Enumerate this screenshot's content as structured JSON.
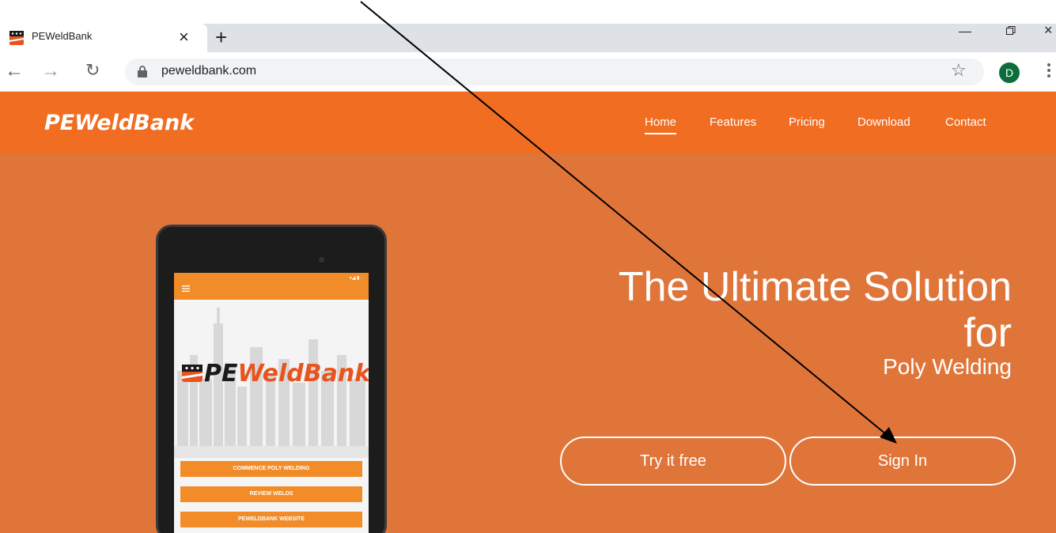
{
  "browser": {
    "tab_title": "PEWeldBank",
    "url": "peweldbank.com",
    "profile_initial": "D"
  },
  "site": {
    "brand": "PEWeldBank",
    "nav": [
      "Home",
      "Features",
      "Pricing",
      "Download",
      "Contact"
    ],
    "active_nav": "Home",
    "hero_line1": "The Ultimate Solution",
    "hero_line2": "for",
    "hero_sub": "Poly Welding",
    "try_button": "Try it free",
    "signin_button": "Sign In",
    "colors": {
      "header": "#f06d22",
      "hero": "#e0753a",
      "app_accent": "#f28c28"
    }
  },
  "tablet_app": {
    "logo_prefix": "PE",
    "logo_suffix": "WeldBank",
    "buttons": [
      "COMMENCE POLY WELDING",
      "REVIEW WELDS",
      "PEWELDBANK WEBSITE"
    ]
  },
  "annotation": {
    "type": "arrow",
    "points_to": "signin-button"
  }
}
